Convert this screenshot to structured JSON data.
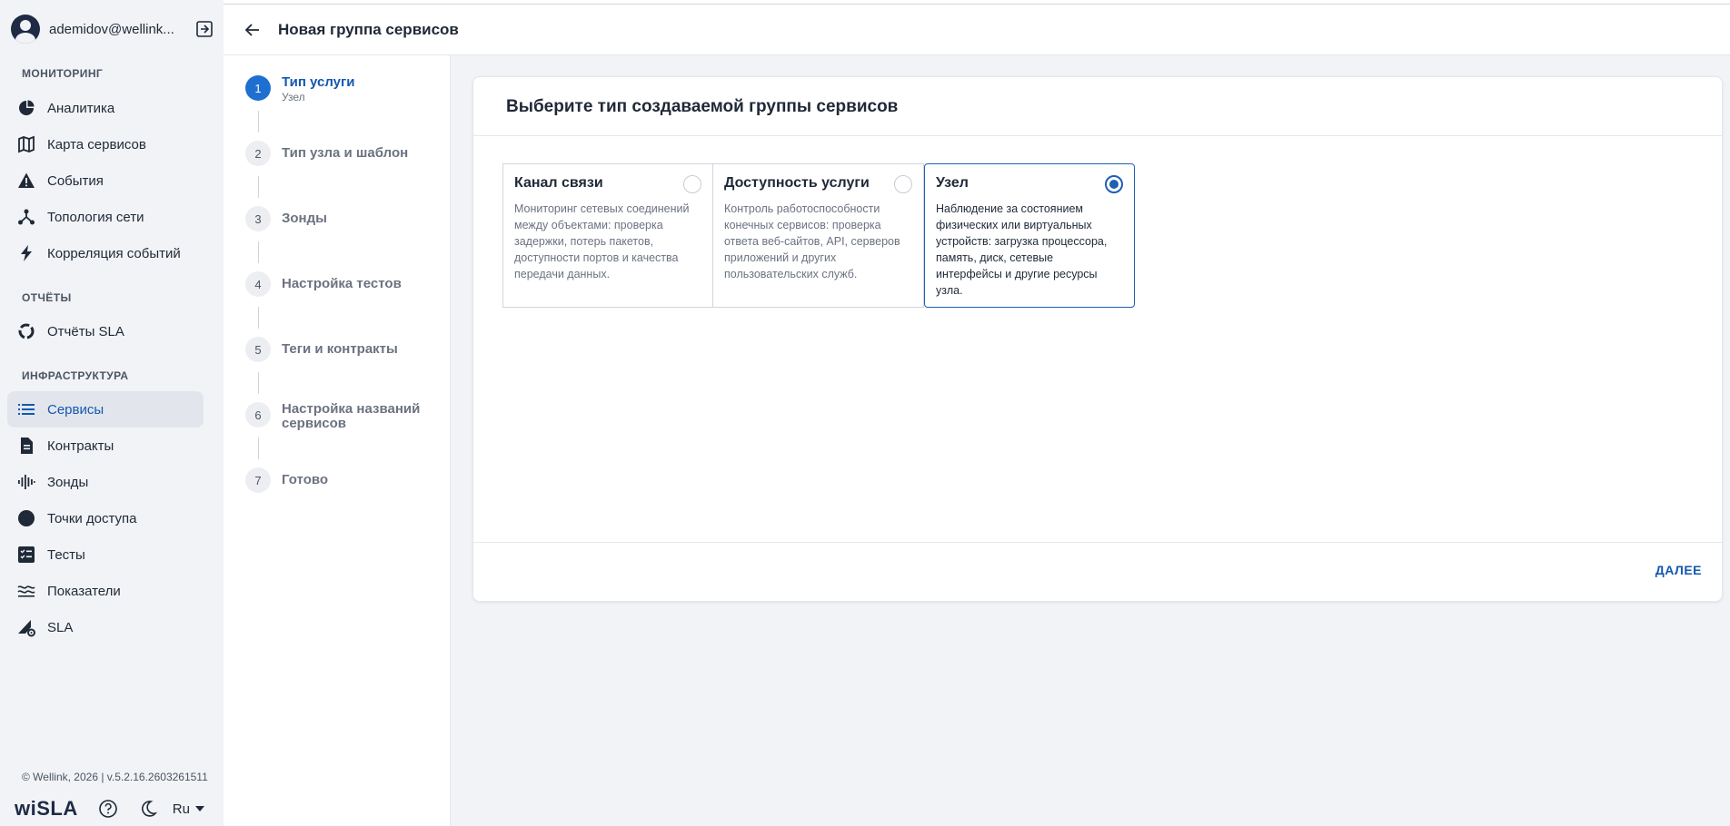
{
  "user": {
    "name": "ademidov@wellink..."
  },
  "sidebar": {
    "sections": [
      {
        "title": "МОНИТОРИНГ"
      },
      {
        "title": "ОТЧЁТЫ"
      },
      {
        "title": "ИНФРАСТРУКТУРА"
      }
    ],
    "items": [
      {
        "label": "Аналитика",
        "icon": "pie-chart-icon"
      },
      {
        "label": "Карта сервисов",
        "icon": "map-icon"
      },
      {
        "label": "События",
        "icon": "warning-icon"
      },
      {
        "label": "Топология сети",
        "icon": "topology-icon"
      },
      {
        "label": "Корреляция событий",
        "icon": "bolt-icon"
      },
      {
        "label": "Отчёты SLA",
        "icon": "donut-icon"
      },
      {
        "label": "Сервисы",
        "icon": "list-icon",
        "active": true
      },
      {
        "label": "Контракты",
        "icon": "document-icon"
      },
      {
        "label": "Зонды",
        "icon": "probe-icon"
      },
      {
        "label": "Точки доступа",
        "icon": "circle-icon"
      },
      {
        "label": "Тесты",
        "icon": "checklist-icon"
      },
      {
        "label": "Показатели",
        "icon": "waves-icon"
      },
      {
        "label": "SLA",
        "icon": "sla-gear-icon"
      }
    ],
    "copyright": "© Wellink, 2026 | v.5.2.16.2603261511",
    "brand": "wiSLA",
    "language": "Ru"
  },
  "header": {
    "title": "Новая группа сервисов"
  },
  "stepper": {
    "steps": [
      {
        "num": "1",
        "label": "Тип услуги",
        "sub": "Узел",
        "active": true
      },
      {
        "num": "2",
        "label": "Тип узла и шаблон"
      },
      {
        "num": "3",
        "label": "Зонды"
      },
      {
        "num": "4",
        "label": "Настройка тестов"
      },
      {
        "num": "5",
        "label": "Теги и контракты"
      },
      {
        "num": "6",
        "label": "Настройка названий сервисов"
      },
      {
        "num": "7",
        "label": "Готово"
      }
    ]
  },
  "main": {
    "card_title": "Выберите тип создаваемой группы сервисов",
    "options": [
      {
        "title": "Канал связи",
        "desc": "Мониторинг сетевых соединений между объектами: проверка задержки, потерь пакетов, доступности портов и качества передачи данных.",
        "selected": false
      },
      {
        "title": "Доступность услуги",
        "desc": "Контроль работоспособности конечных сервисов: проверка ответа веб-сайтов, API, серверов приложений и других пользовательских служб.",
        "selected": false
      },
      {
        "title": "Узел",
        "desc": "Наблюдение за состоянием физических или виртуальных устройств: загрузка процессора, память, диск, сетевые интерфейсы и другие ресурсы узла.",
        "selected": true
      }
    ],
    "next_label": "ДАЛЕЕ"
  },
  "colors": {
    "accent": "#1557b0",
    "active_step": "#1f6fd1"
  }
}
